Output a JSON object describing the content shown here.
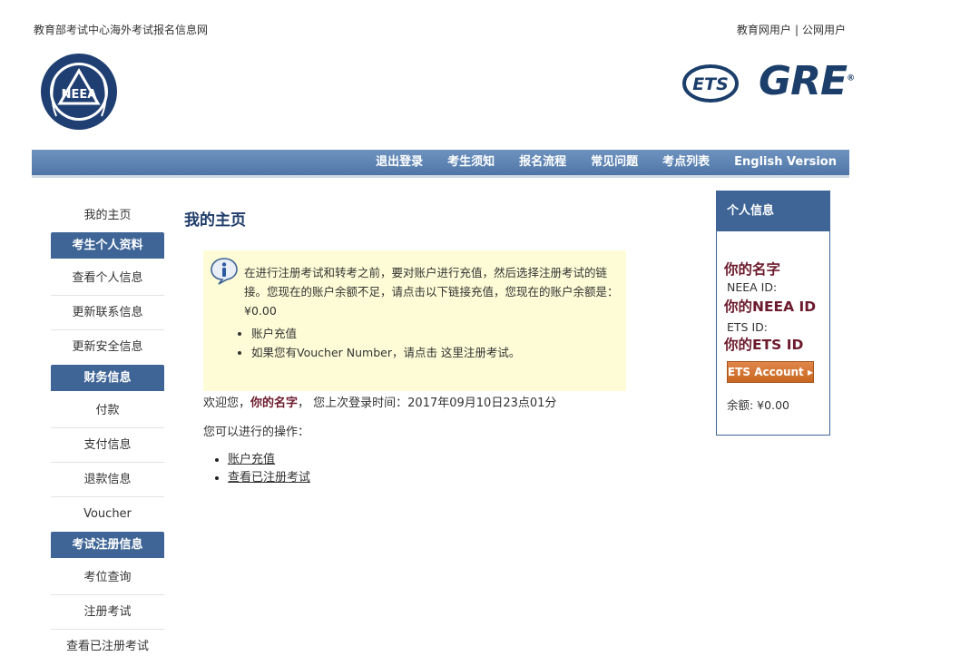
{
  "header": {
    "site_title": "教育部考试中心海外考试报名信息网",
    "user_edu": "教育网用户",
    "separator": "|",
    "user_public": "公网用户",
    "neea_logo_text": "NEEA",
    "ets_logo_text": "ETS",
    "gre_logo_text": "GRE",
    "gre_mark": "®"
  },
  "nav": {
    "items": [
      "退出登录",
      "考生须知",
      "报名流程",
      "常见问题",
      "考点列表",
      "English Version"
    ]
  },
  "sidebar": {
    "home": "我的主页",
    "section_profile": "考生个人资料",
    "view_profile": "查看个人信息",
    "update_contact": "更新联系信息",
    "update_security": "更新安全信息",
    "section_finance": "财务信息",
    "payment": "付款",
    "payment_info": "支付信息",
    "refund_info": "退款信息",
    "voucher": "Voucher",
    "section_exam": "考试注册信息",
    "seat_query": "考位查询",
    "register_exam": "注册考试",
    "view_registered": "查看已注册考试"
  },
  "main": {
    "title": "我的主页",
    "notice_text": "在进行注册考试和转考之前，要对账户进行充值，然后选择注册考试的链接。您现在的账户余额不足，请点击以下链接充值，您现在的账户余额是：¥0.00",
    "notice_items": [
      "账户充值",
      "如果您有Voucher Number，请点击 这里注册考试。"
    ],
    "welcome_prefix": "欢迎您，",
    "welcome_name": "你的名字",
    "welcome_suffix": "， 您上次登录时间：2017年09月10日23点01分",
    "ops_label": "您可以进行的操作：",
    "ops": [
      "账户充值",
      "查看已注册考试"
    ]
  },
  "panel": {
    "title": "个人信息",
    "name": "你的名字",
    "neea_label": "NEEA ID:",
    "neea_id": "你的NEEA ID",
    "ets_label": "ETS ID:",
    "ets_id": "你的ETS ID",
    "ets_button": "ETS Account",
    "balance": "余额: ¥0.00"
  },
  "colors": {
    "nav_blue": "#4f76a8",
    "section_blue": "#3f6596",
    "name_maroon": "#6c1a2c",
    "notice_bg": "#fdfcd6",
    "ets_orange": "#c86720"
  }
}
